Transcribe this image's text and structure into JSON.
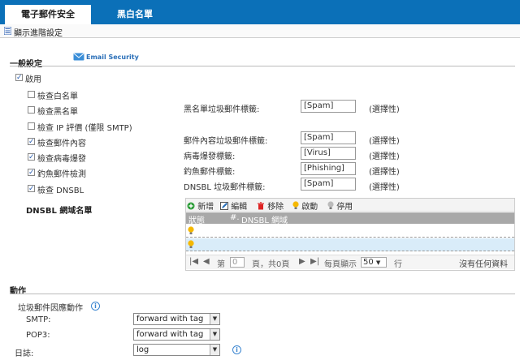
{
  "tabs": [
    {
      "label": "電子郵件安全"
    },
    {
      "label": "黑白名單"
    }
  ],
  "advanced_link": "顯示進階設定",
  "general": {
    "title": "一般設定",
    "logo_text": "Email Security",
    "enable_label": "啟用",
    "checks": [
      {
        "label": "檢查白名單",
        "checked": false
      },
      {
        "label": "檢查黑名單",
        "checked": false
      },
      {
        "label": "檢查 IP 評價 (僅限 SMTP)",
        "checked": false
      },
      {
        "label": "檢查郵件內容",
        "checked": true
      },
      {
        "label": "檢查病毒爆發",
        "checked": true
      },
      {
        "label": "釣魚郵件檢測",
        "checked": true
      },
      {
        "label": "檢查 DNSBL",
        "checked": true
      }
    ],
    "tag_fields": [
      {
        "label": "黑名單垃圾郵件標籤:",
        "value": "[Spam]",
        "optional": "(選擇性)"
      },
      {
        "label": "郵件內容垃圾郵件標籤:",
        "value": "[Spam]",
        "optional": "(選擇性)"
      },
      {
        "label": "病毒爆發標籤:",
        "value": "[Virus]",
        "optional": "(選擇性)"
      },
      {
        "label": "釣魚郵件標籤:",
        "value": "[Phishing]",
        "optional": "(選擇性)"
      },
      {
        "label": "DNSBL 垃圾郵件標籤:",
        "value": "[Spam]",
        "optional": "(選擇性)"
      }
    ]
  },
  "dnsbl": {
    "title": "DNSBL 網域名單",
    "toolbar": {
      "add": "新增",
      "edit": "編輯",
      "remove": "移除",
      "activate": "啟動",
      "deactivate": "停用"
    },
    "columns": [
      "狀態",
      "#.",
      "DNSBL 網域"
    ],
    "pager": {
      "page_label": "第",
      "page_value": "0",
      "page_total": "頁，共0頁",
      "per_page_label": "每頁顯示",
      "per_page_value": "50",
      "rows_label": "行",
      "empty_text": "沒有任何資料"
    }
  },
  "action": {
    "title": "動作",
    "spam_action_label": "垃圾郵件因應動作",
    "smtp_label": "SMTP:",
    "smtp_value": "forward with tag",
    "pop3_label": "POP3:",
    "pop3_value": "forward with tag",
    "log_label": "日誌:",
    "log_value": "log"
  }
}
